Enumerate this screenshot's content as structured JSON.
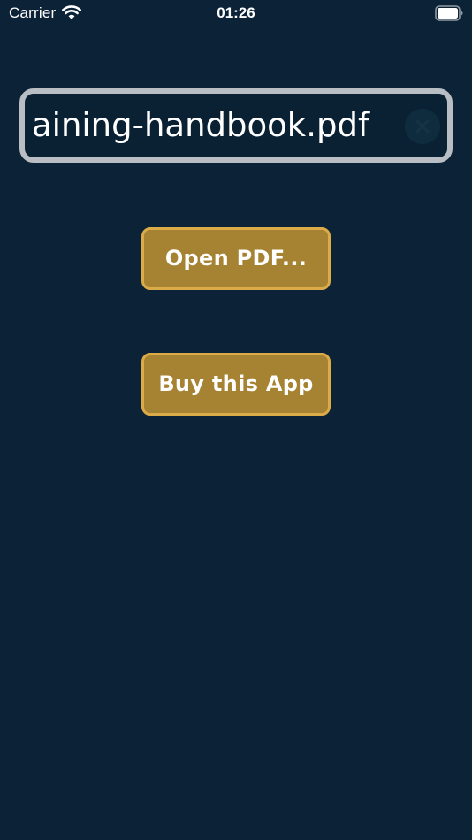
{
  "status_bar": {
    "carrier": "Carrier",
    "time": "01:26",
    "wifi_icon": "wifi-icon",
    "battery_icon": "battery-full-icon"
  },
  "file_field": {
    "value": "aining-handbook.pdf",
    "clear_icon": "clear-circle-icon"
  },
  "buttons": {
    "open_pdf": "Open PDF...",
    "buy_app": "Buy this App"
  },
  "colors": {
    "background": "#0c2237",
    "button_fill": "#a68233",
    "button_border": "#dbab47",
    "field_border": "#b9bec4"
  }
}
